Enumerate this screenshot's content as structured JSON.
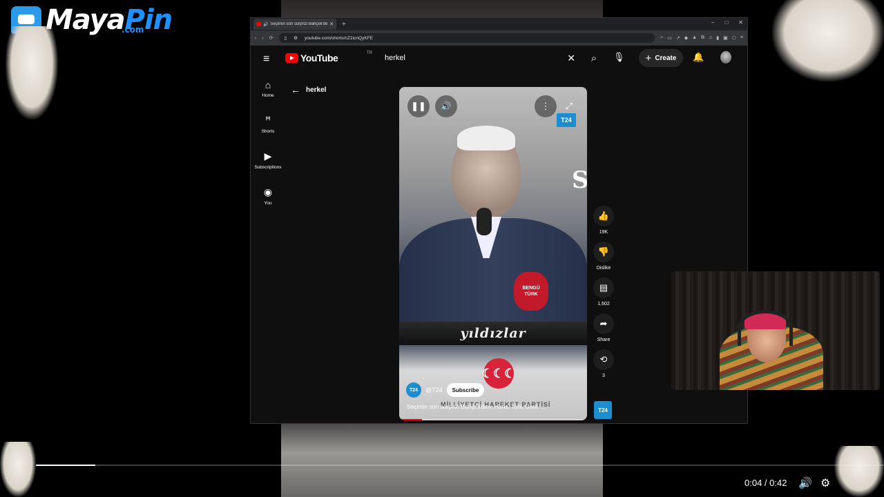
{
  "overlay": {
    "logo_main": "Maya",
    "logo_accent": "Pin",
    "logo_suffix": ".com"
  },
  "browser": {
    "tab_title": "Seçimin son sürprizi Bahçeli'den",
    "url": "youtube.com/shorts/cZ1tcnQyKFE",
    "window_controls": [
      "–",
      "□",
      "✕"
    ]
  },
  "youtube": {
    "wordmark": "YouTube",
    "country": "TR",
    "search_query": "herkel",
    "create_label": "Create",
    "back_label": "herkel",
    "sidebar": [
      {
        "label": "Home",
        "icon": "home-icon"
      },
      {
        "label": "Shorts",
        "icon": "shorts-icon"
      },
      {
        "label": "Subscriptions",
        "icon": "subscriptions-icon"
      },
      {
        "label": "You",
        "icon": "account-icon"
      }
    ]
  },
  "short": {
    "channel_badge": "T24",
    "channel_handle": "@T24",
    "subscribe_label": "Subscribe",
    "title": "Seçimin son sürprizi Bahçeli'den: Hans, Toni, Coni, ...",
    "sign_text": "yıldızlar",
    "mic_text_1": "BENGÜ",
    "mic_text_2": "TÜRK",
    "party_text": "MİLLİYETÇİ HAREKET PARTİSİ",
    "emblem_text": "☾☾☾",
    "banner_letter": "S",
    "progress_fraction": 0.12
  },
  "actions": {
    "likes": "19K",
    "dislike_label": "Dislike",
    "comments": "1,602",
    "share_label": "Share",
    "remix_count": "3",
    "rail_badge": "T24"
  },
  "player": {
    "time": "0:04 / 0:42",
    "progress_fraction": 0.07
  },
  "colors": {
    "youtube_red": "#ff0000",
    "t24_blue": "#1c8ed0",
    "brand_blue": "#1e90ff"
  }
}
